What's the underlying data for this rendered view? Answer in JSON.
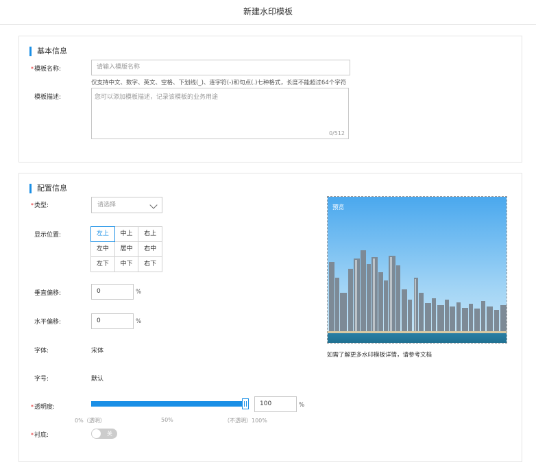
{
  "header": {
    "title": "新建水印模板"
  },
  "basic": {
    "title": "基本信息",
    "name_label": "模板名称:",
    "name_placeholder": "请输入模版名称",
    "name_hint": "仅支持中文、数字、英文、空格、下划线(_)、连字符(-)和句点(.)七种格式，长度不能超过64个字符",
    "desc_label": "模板描述:",
    "desc_placeholder": "您可以添加模板描述，记录该模板的业务用途",
    "desc_counter": "0/512"
  },
  "config": {
    "title": "配置信息",
    "type_label": "类型:",
    "type_value": "请选择",
    "position_label": "显示位置:",
    "positions": [
      "左上",
      "中上",
      "右上",
      "左中",
      "居中",
      "右中",
      "左下",
      "中下",
      "右下"
    ],
    "selected_position": "左上",
    "v_offset_label": "垂直偏移:",
    "v_offset_value": "0",
    "h_offset_label": "水平偏移:",
    "h_offset_value": "0",
    "percent": "%",
    "font_label": "字体:",
    "font_value": "宋体",
    "size_label": "字号:",
    "size_value": "默认",
    "opacity_label": "透明度:",
    "opacity_value": "100",
    "opacity_level": 1.0,
    "scale_min": "0%（透明）",
    "scale_mid": "50%",
    "scale_max": "（不透明）100%",
    "backing_label": "衬底:",
    "backing_toggle": "关",
    "preview_label": "预览",
    "preview_note": "如需了解更多水印模板详情，请参考文档"
  },
  "colors": {
    "accent": "#1a8fe6",
    "required": "#e02020"
  }
}
